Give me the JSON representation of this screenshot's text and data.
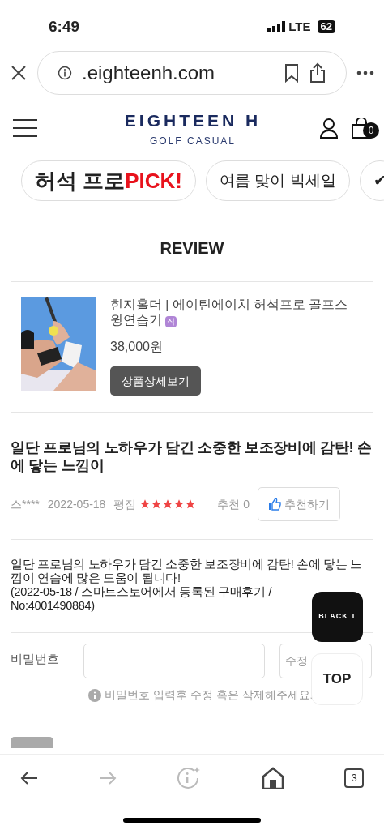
{
  "status_bar": {
    "time": "6:49",
    "network": "LTE",
    "battery": "62"
  },
  "browser": {
    "url": ".eighteenh.com",
    "tab_count": "3"
  },
  "header": {
    "logo_title": "EIGHTEEN H",
    "logo_subtitle": "GOLF CASUAL",
    "cart_count": "0"
  },
  "chips": [
    {
      "kind": "promo",
      "text": "허석 프로 ",
      "highlight": "PICK!"
    },
    {
      "kind": "plain",
      "text": "여름 맞이 빅세일"
    },
    {
      "kind": "plain",
      "text": "✔"
    }
  ],
  "page_title": "REVIEW",
  "product": {
    "kind": "picture",
    "name": "힌지홀더 | 에이틴에이치 허석프로 골프스윙연습기",
    "tag": "직",
    "price": "38,000원",
    "button": "상품상세보기"
  },
  "review": {
    "title": "일단 프로님의 노하우가 담긴 소중한 보조장비에 감탄! 손에 닿는 느낌이",
    "author": "스****",
    "date": "2022-05-18",
    "rating_label": "평점",
    "stars": 5,
    "recommend": "추천 0",
    "recommend_button": "추천하기",
    "body": [
      "일단 프로님의 노하우가 담긴 소중한 보조장비에 감탄! 손에 닿는 느낌이 연습에 많은 도움이 됩니다!",
      "(2022-05-18 / 스마트스토어에서 등록된 구매후기 / No:4001490884)"
    ]
  },
  "password": {
    "label": "비밀번호",
    "edit_button": "수정",
    "hint": "비밀번호 입력후 수정 혹은 삭제해주세요."
  },
  "floating": {
    "badge": "BLACK T",
    "top_button": "TOP"
  }
}
